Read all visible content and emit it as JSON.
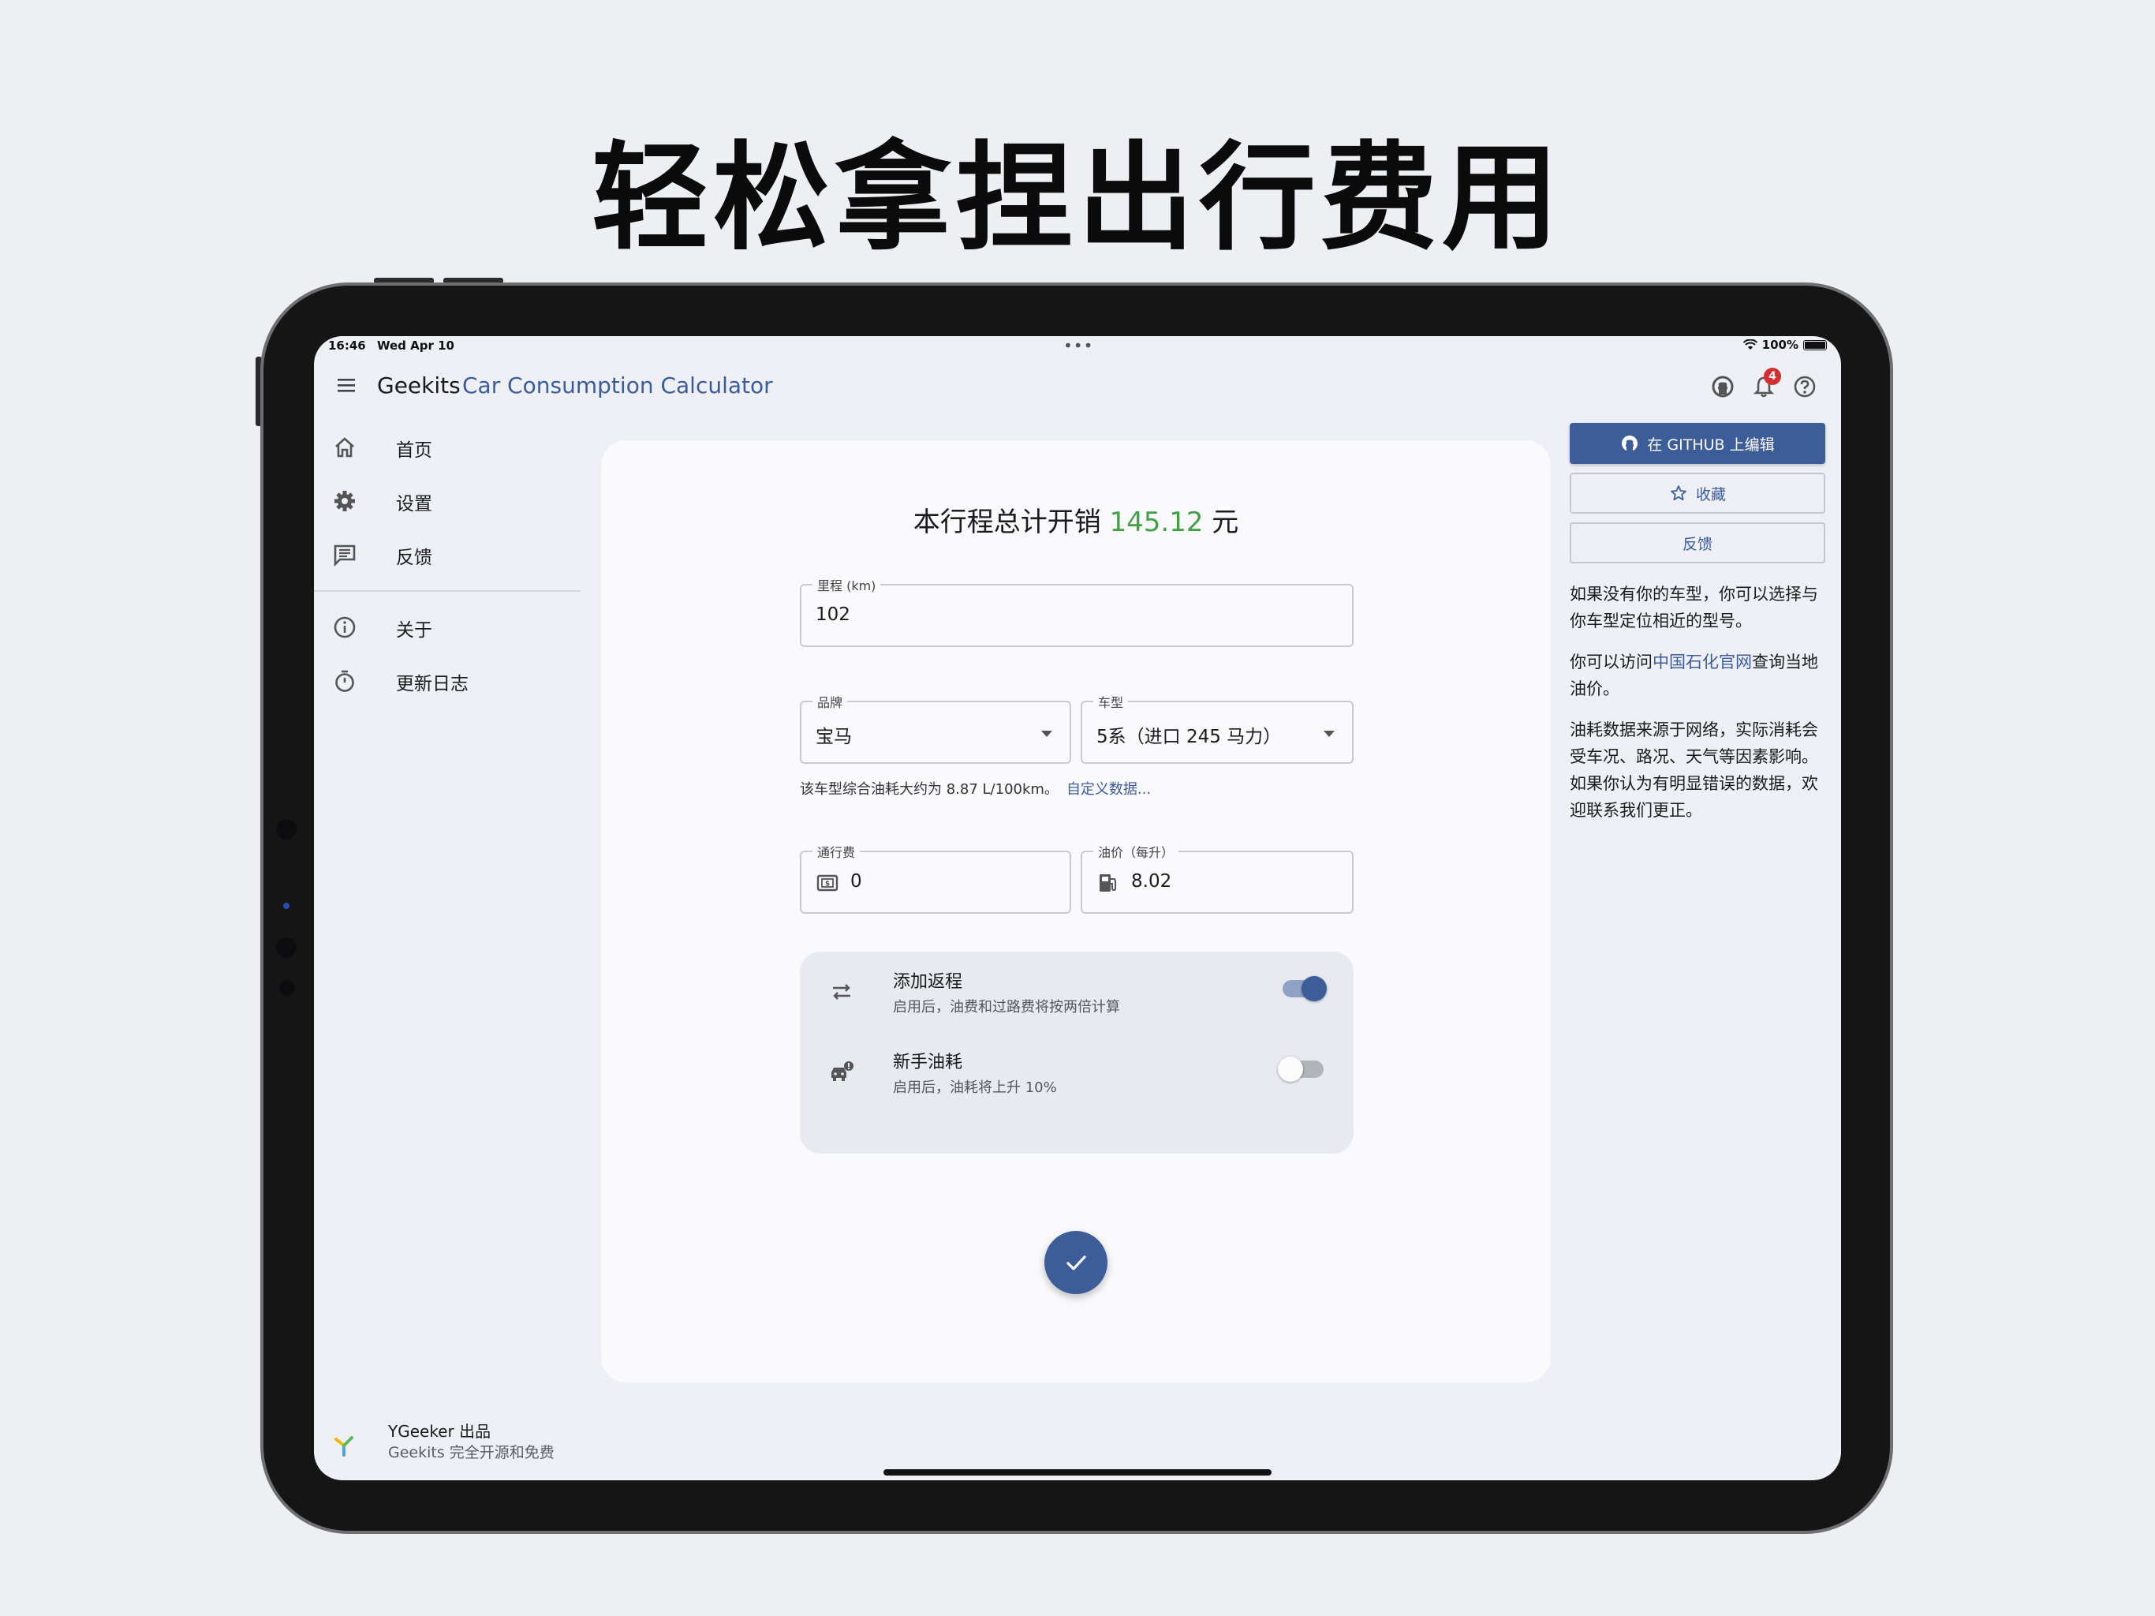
{
  "headline": "轻松拿捏出行费用",
  "status": {
    "time": "16:46",
    "date": "Wed Apr 10",
    "battery": "100%"
  },
  "appbar": {
    "title": "Geekits",
    "subtitle": "Car Consumption Calculator",
    "notification_count": "4"
  },
  "nav": {
    "items": [
      {
        "label": "首页",
        "icon": "home-icon"
      },
      {
        "label": "设置",
        "icon": "gear-icon"
      },
      {
        "label": "反馈",
        "icon": "feedback-icon"
      },
      {
        "label": "关于",
        "icon": "info-icon"
      },
      {
        "label": "更新日志",
        "icon": "timer-icon"
      }
    ]
  },
  "footer": {
    "line1": "YGeeker 出品",
    "line2": "Geekits 完全开源和免费"
  },
  "calc": {
    "total_prefix": "本行程总计开销",
    "total_amount": "145.12",
    "total_suffix": "元",
    "distance_label": "里程 (km)",
    "distance_value": "102",
    "brand_label": "品牌",
    "brand_value": "宝马",
    "model_label": "车型",
    "model_value": "5系（进口 245 马力）",
    "hint_text": "该车型综合油耗大约为 8.87 L/100km。",
    "hint_link": "自定义数据...",
    "toll_label": "通行费",
    "toll_value": "0",
    "fuel_label": "油价（每升）",
    "fuel_value": "8.02",
    "return_title": "添加返程",
    "return_sub": "启用后，油费和过路费将按两倍计算",
    "return_on": true,
    "novice_title": "新手油耗",
    "novice_sub": "启用后，油耗将上升 10%",
    "novice_on": false
  },
  "right": {
    "github_button": "在 GITHUB 上编辑",
    "favorite_button": "收藏",
    "feedback_button": "反馈",
    "p1": "如果没有你的车型，你可以选择与你车型定位相近的型号。",
    "p2_before": "你可以访问",
    "p2_link": "中国石化官网",
    "p2_after": "查询当地油价。",
    "p3": "油耗数据来源于网络，实际消耗会受车况、路况、天气等因素影响。如果你认为有明显错误的数据，欢迎联系我们更正。"
  },
  "colors": {
    "accent": "#3d5d99",
    "amount": "#43a047",
    "link": "#3b5c9c",
    "badge": "#d32f2f"
  }
}
